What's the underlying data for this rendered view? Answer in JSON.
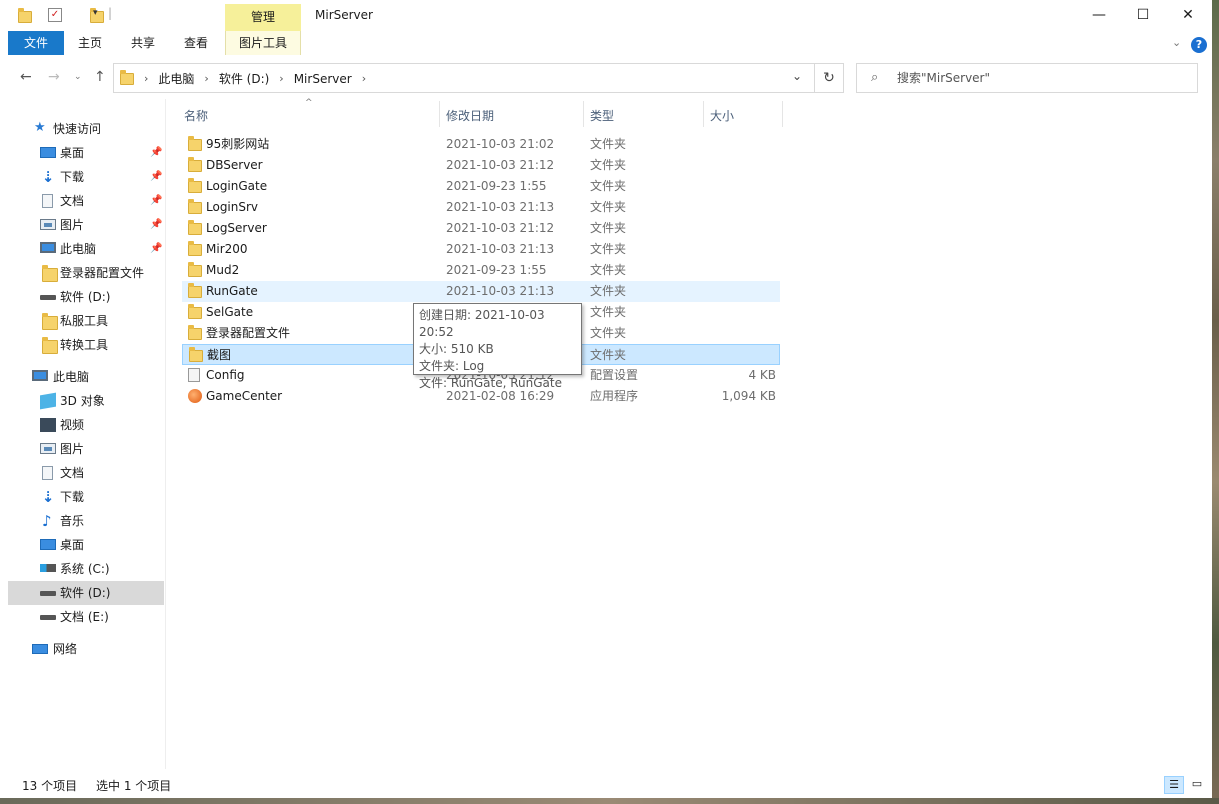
{
  "window": {
    "title": "MirServer",
    "manage_tab": "管理",
    "caption": {
      "minimize": "—",
      "maximize": "☐",
      "close": "✕"
    }
  },
  "ribbon": {
    "tabs": [
      "文件",
      "主页",
      "共享",
      "查看",
      "图片工具"
    ]
  },
  "address": {
    "crumbs": [
      "此电脑",
      "软件 (D:)",
      "MirServer"
    ],
    "search_placeholder": "搜索\"MirServer\""
  },
  "sidebar": {
    "quick_access": "快速访问",
    "items": [
      {
        "label": "桌面",
        "icon": "desktop-icon",
        "pinned": true
      },
      {
        "label": "下载",
        "icon": "download-icon",
        "pinned": true
      },
      {
        "label": "文档",
        "icon": "document-icon",
        "pinned": true
      },
      {
        "label": "图片",
        "icon": "picture-icon",
        "pinned": true
      },
      {
        "label": "此电脑",
        "icon": "computer-icon",
        "pinned": true
      },
      {
        "label": "登录器配置文件",
        "icon": "folder-icon",
        "pinned": false
      },
      {
        "label": "软件 (D:)",
        "icon": "drive-icon",
        "pinned": false
      },
      {
        "label": "私服工具",
        "icon": "folder-icon",
        "pinned": false
      },
      {
        "label": "转换工具",
        "icon": "folder-icon",
        "pinned": false
      }
    ],
    "this_pc": "此电脑",
    "pc_items": [
      {
        "label": "3D 对象",
        "icon": "3d-objects-icon"
      },
      {
        "label": "视频",
        "icon": "video-icon"
      },
      {
        "label": "图片",
        "icon": "picture-icon"
      },
      {
        "label": "文档",
        "icon": "document-icon"
      },
      {
        "label": "下载",
        "icon": "download-icon"
      },
      {
        "label": "音乐",
        "icon": "music-icon"
      },
      {
        "label": "桌面",
        "icon": "desktop-icon"
      },
      {
        "label": "系统 (C:)",
        "icon": "system-drive-icon"
      },
      {
        "label": "软件 (D:)",
        "icon": "drive-icon",
        "selected": true
      },
      {
        "label": "文档 (E:)",
        "icon": "drive-icon"
      }
    ],
    "network": "网络"
  },
  "columns": {
    "name": "名称",
    "date": "修改日期",
    "type": "类型",
    "size": "大小"
  },
  "files": [
    {
      "name": "95刺影网站",
      "date": "2021-10-03 21:02",
      "type": "文件夹",
      "size": "",
      "icon": "folder-icon"
    },
    {
      "name": "DBServer",
      "date": "2021-10-03 21:12",
      "type": "文件夹",
      "size": "",
      "icon": "folder-icon"
    },
    {
      "name": "LoginGate",
      "date": "2021-09-23 1:55",
      "type": "文件夹",
      "size": "",
      "icon": "folder-icon"
    },
    {
      "name": "LoginSrv",
      "date": "2021-10-03 21:13",
      "type": "文件夹",
      "size": "",
      "icon": "folder-icon"
    },
    {
      "name": "LogServer",
      "date": "2021-10-03 21:12",
      "type": "文件夹",
      "size": "",
      "icon": "folder-icon"
    },
    {
      "name": "Mir200",
      "date": "2021-10-03 21:13",
      "type": "文件夹",
      "size": "",
      "icon": "folder-icon"
    },
    {
      "name": "Mud2",
      "date": "2021-09-23 1:55",
      "type": "文件夹",
      "size": "",
      "icon": "folder-icon"
    },
    {
      "name": "RunGate",
      "date": "2021-10-03 21:13",
      "type": "文件夹",
      "size": "",
      "icon": "folder-icon",
      "state": "hover"
    },
    {
      "name": "SelGate",
      "date": "",
      "type": "文件夹",
      "size": "",
      "icon": "folder-icon"
    },
    {
      "name": "登录器配置文件",
      "date": "",
      "type": "文件夹",
      "size": "",
      "icon": "folder-icon"
    },
    {
      "name": "截图",
      "date": "",
      "type": "文件夹",
      "size": "",
      "icon": "folder-icon",
      "state": "selected"
    },
    {
      "name": "Config",
      "date": "2021-10-03 21:12",
      "type": "配置设置",
      "size": "4 KB",
      "icon": "config-file-icon"
    },
    {
      "name": "GameCenter",
      "date": "2021-02-08 16:29",
      "type": "应用程序",
      "size": "1,094 KB",
      "icon": "application-icon"
    }
  ],
  "tooltip": {
    "lines": [
      "创建日期: 2021-10-03 20:52",
      "大小: 510 KB",
      "文件夹: Log",
      "文件: RunGate, RunGate"
    ]
  },
  "status": {
    "count": "13 个项目",
    "selected": "选中 1 个项目"
  },
  "colors": {
    "accent": "#1979ca",
    "selection": "#cce8ff",
    "hover": "#e5f3ff",
    "manage_tab": "#f6f09a"
  }
}
